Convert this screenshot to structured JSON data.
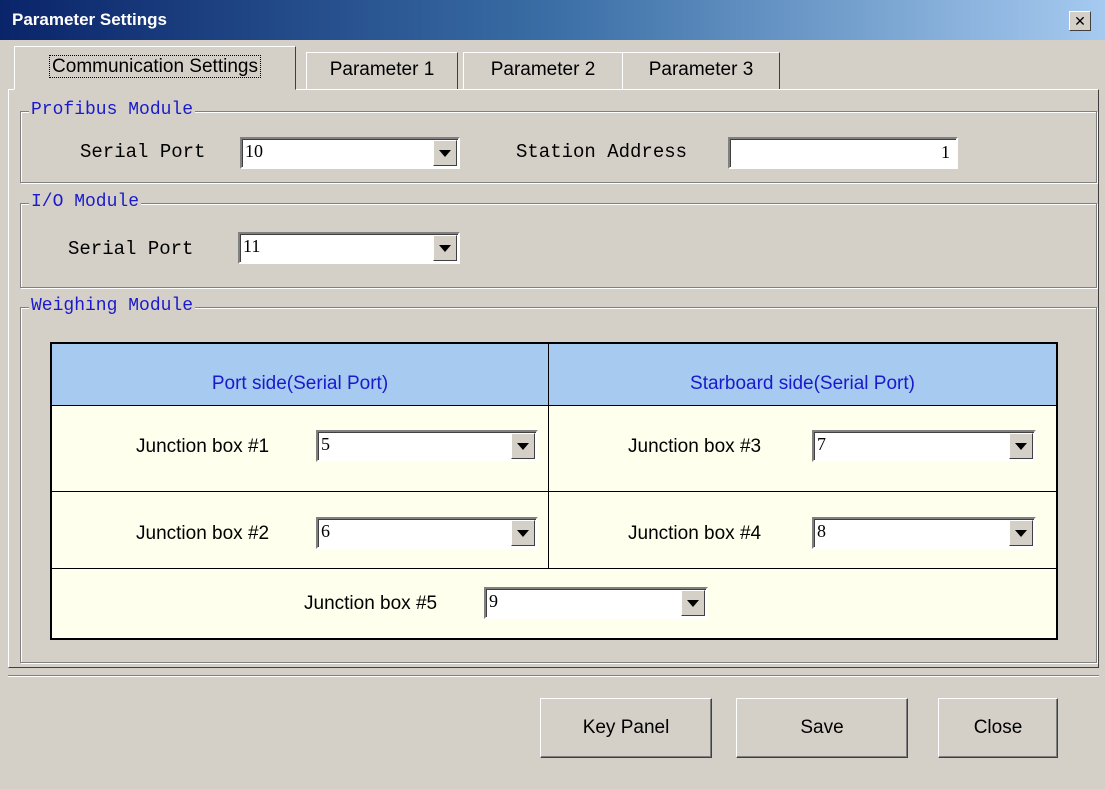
{
  "window": {
    "title": "Parameter Settings",
    "close_glyph": "✕"
  },
  "tabs": [
    {
      "label": "Communication Settings",
      "active": true
    },
    {
      "label": "Parameter 1"
    },
    {
      "label": "Parameter 2"
    },
    {
      "label": "Parameter 3"
    }
  ],
  "profibus": {
    "legend": "Profibus Module",
    "serial_port_label": "Serial Port",
    "serial_port_value": "10",
    "station_address_label": "Station Address",
    "station_address_value": "1"
  },
  "io": {
    "legend": "I/O Module",
    "serial_port_label": "Serial Port",
    "serial_port_value": "11"
  },
  "weighing": {
    "legend": "Weighing Module",
    "port_header": "Port side(Serial Port)",
    "starboard_header": "Starboard side(Serial Port)",
    "boxes": [
      {
        "label": "Junction box #1",
        "value": "5"
      },
      {
        "label": "Junction box #2",
        "value": "6"
      },
      {
        "label": "Junction box #3",
        "value": "7"
      },
      {
        "label": "Junction box #4",
        "value": "8"
      },
      {
        "label": "Junction box #5",
        "value": "9"
      }
    ]
  },
  "buttons": {
    "key_panel": "Key Panel",
    "save": "Save",
    "close": "Close"
  },
  "colors": {
    "title_gradient_start": "#0a246a",
    "legend_text": "#1a1acc",
    "table_header_bg": "#a6caf0",
    "table_body_bg": "#ffffee"
  }
}
